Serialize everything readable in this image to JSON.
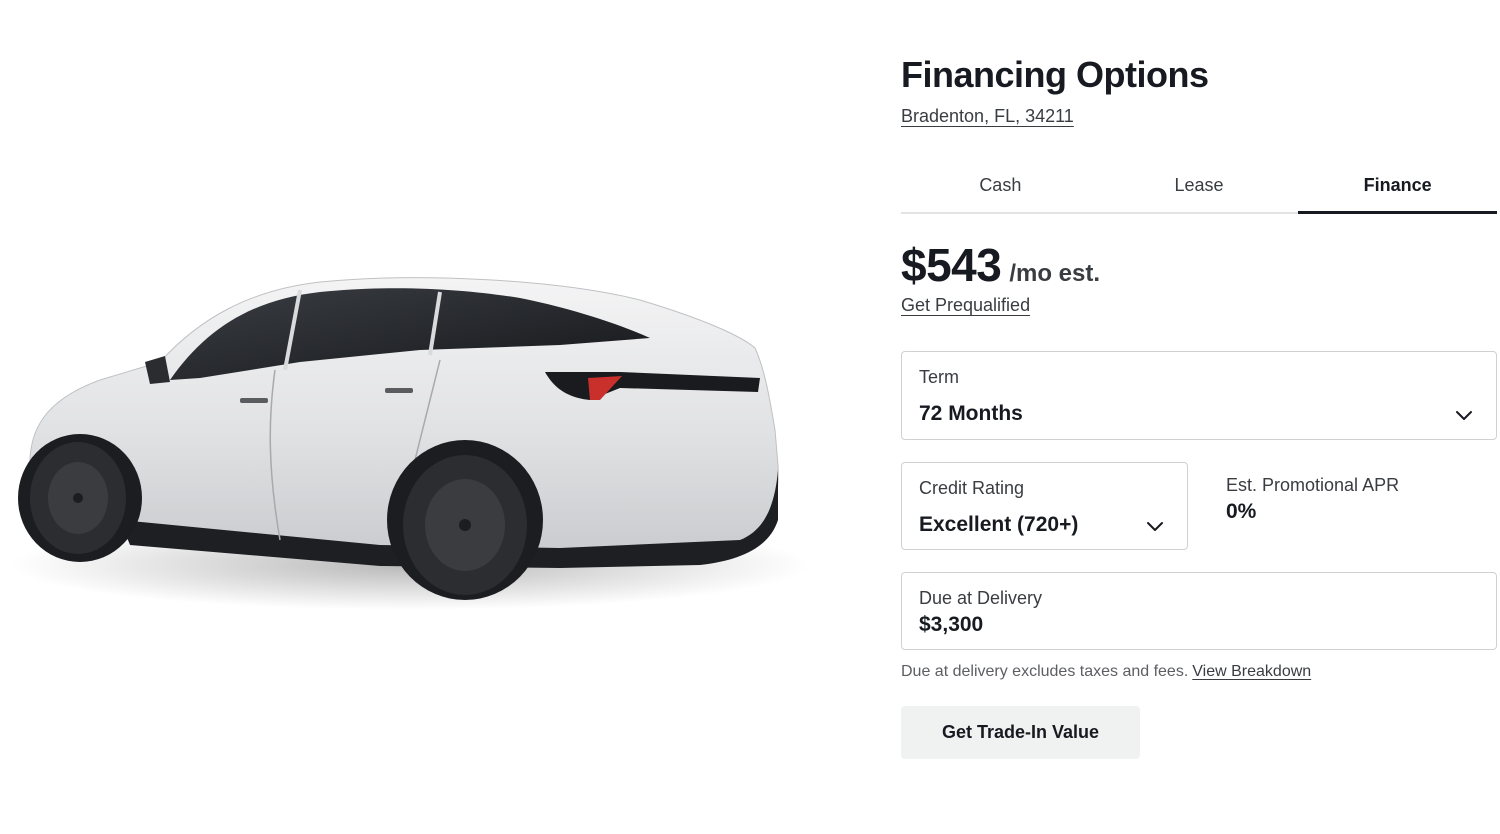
{
  "vehicle_image": {
    "alt": "Model Y",
    "paint_color": "#e4e5e7"
  },
  "header": {
    "title": "Financing Options",
    "location": "Bradenton, FL, 34211"
  },
  "tabs": [
    {
      "label": "Cash",
      "active": false
    },
    {
      "label": "Lease",
      "active": false
    },
    {
      "label": "Finance",
      "active": true
    }
  ],
  "payment": {
    "amount": "$543",
    "suffix": "/mo est.",
    "prequalify_link": "Get Prequalified"
  },
  "term": {
    "label": "Term",
    "value": "72 Months",
    "icon": "chevron-down-icon"
  },
  "credit_rating": {
    "label": "Credit Rating",
    "value": "Excellent (720+)",
    "icon": "chevron-down-icon"
  },
  "apr": {
    "label": "Est. Promotional APR",
    "value": "0%"
  },
  "due_at_delivery": {
    "label": "Due at Delivery",
    "value": "$3,300"
  },
  "note": {
    "text": "Due at delivery excludes taxes and fees.",
    "link": "View Breakdown"
  },
  "trade_in_button": "Get Trade-In Value",
  "colors": {
    "text_primary": "#171a20",
    "text_secondary": "#393c41",
    "border": "#d0d1d2",
    "button_bg": "#f0f1f1"
  }
}
